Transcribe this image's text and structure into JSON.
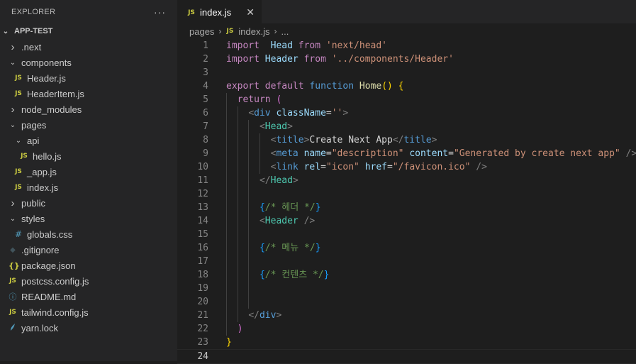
{
  "sidebar": {
    "title": "EXPLORER",
    "more": "···",
    "project": "APP-TEST",
    "items": [
      {
        "label": ".next",
        "kind": "folder",
        "open": false,
        "depth": 1
      },
      {
        "label": "components",
        "kind": "folder",
        "open": true,
        "depth": 1
      },
      {
        "label": "Header.js",
        "kind": "js",
        "depth": 2
      },
      {
        "label": "HeaderItem.js",
        "kind": "js",
        "depth": 2
      },
      {
        "label": "node_modules",
        "kind": "folder",
        "open": false,
        "depth": 1
      },
      {
        "label": "pages",
        "kind": "folder",
        "open": true,
        "depth": 1
      },
      {
        "label": "api",
        "kind": "folder",
        "open": true,
        "depth": 2
      },
      {
        "label": "hello.js",
        "kind": "js",
        "depth": 3
      },
      {
        "label": "_app.js",
        "kind": "js",
        "depth": 2
      },
      {
        "label": "index.js",
        "kind": "js",
        "depth": 2
      },
      {
        "label": "public",
        "kind": "folder",
        "open": false,
        "depth": 1
      },
      {
        "label": "styles",
        "kind": "folder",
        "open": true,
        "depth": 1
      },
      {
        "label": "globals.css",
        "kind": "css",
        "depth": 2
      },
      {
        "label": ".gitignore",
        "kind": "git",
        "depth": 1
      },
      {
        "label": "package.json",
        "kind": "json",
        "depth": 1
      },
      {
        "label": "postcss.config.js",
        "kind": "js",
        "depth": 1
      },
      {
        "label": "README.md",
        "kind": "info",
        "depth": 1
      },
      {
        "label": "tailwind.config.js",
        "kind": "js",
        "depth": 1
      },
      {
        "label": "yarn.lock",
        "kind": "yarn",
        "depth": 1
      }
    ]
  },
  "tab": {
    "label": "index.js",
    "icon": "JS",
    "close": "✕"
  },
  "breadcrumb": {
    "folder": "pages",
    "file_icon": "JS",
    "file": "index.js",
    "more": "..."
  },
  "icons": {
    "js": "JS",
    "css": "#",
    "git": "◆",
    "json": "{}",
    "info": "ⓘ",
    "yarn": "🧶"
  },
  "editor": {
    "active_line": 24,
    "lines": [
      [
        [
          "kw",
          "import"
        ],
        [
          "",
          "  "
        ],
        [
          "var",
          "Head"
        ],
        [
          "",
          ""
        ],
        [
          "kw",
          " from"
        ],
        [
          "",
          " "
        ],
        [
          "str",
          "'next/head'"
        ]
      ],
      [
        [
          "kw",
          "import"
        ],
        [
          "",
          " "
        ],
        [
          "var",
          "Header"
        ],
        [
          "kw",
          " from"
        ],
        [
          "",
          " "
        ],
        [
          "str",
          "'../components/Header'"
        ]
      ],
      [],
      [
        [
          "kw",
          "export"
        ],
        [
          "",
          " "
        ],
        [
          "kw",
          "default"
        ],
        [
          "",
          " "
        ],
        [
          "kw2",
          "function"
        ],
        [
          "",
          " "
        ],
        [
          "fn",
          "Home"
        ],
        [
          "br",
          "()"
        ],
        [
          "",
          " "
        ],
        [
          "br",
          "{"
        ]
      ],
      [
        [
          "",
          ""
        ],
        [
          "kw",
          "  return"
        ],
        [
          "",
          " "
        ],
        [
          "br2",
          "("
        ]
      ],
      [
        [
          "",
          "    "
        ],
        [
          "gray",
          "<"
        ],
        [
          "tag",
          "div"
        ],
        [
          "",
          " "
        ],
        [
          "attr",
          "className"
        ],
        [
          "",
          "="
        ],
        [
          "str",
          "''"
        ],
        [
          "gray",
          ">"
        ]
      ],
      [
        [
          "",
          "      "
        ],
        [
          "gray",
          "<"
        ],
        [
          "comp",
          "Head"
        ],
        [
          "gray",
          ">"
        ]
      ],
      [
        [
          "",
          "        "
        ],
        [
          "gray",
          "<"
        ],
        [
          "tag",
          "title"
        ],
        [
          "gray",
          ">"
        ],
        [
          "",
          "Create Next App"
        ],
        [
          "gray",
          "</"
        ],
        [
          "tag",
          "title"
        ],
        [
          "gray",
          ">"
        ]
      ],
      [
        [
          "",
          "        "
        ],
        [
          "gray",
          "<"
        ],
        [
          "tag",
          "meta"
        ],
        [
          "",
          " "
        ],
        [
          "attr",
          "name"
        ],
        [
          "",
          "="
        ],
        [
          "str",
          "\"description\""
        ],
        [
          "",
          " "
        ],
        [
          "attr",
          "content"
        ],
        [
          "",
          "="
        ],
        [
          "str",
          "\"Generated by create next app\""
        ],
        [
          "",
          " "
        ],
        [
          "gray",
          "/>"
        ]
      ],
      [
        [
          "",
          "        "
        ],
        [
          "gray",
          "<"
        ],
        [
          "tag",
          "link"
        ],
        [
          "",
          " "
        ],
        [
          "attr",
          "rel"
        ],
        [
          "",
          "="
        ],
        [
          "str",
          "\"icon\""
        ],
        [
          "",
          " "
        ],
        [
          "attr",
          "href"
        ],
        [
          "",
          "="
        ],
        [
          "str",
          "\"/favicon.ico\""
        ],
        [
          "",
          " "
        ],
        [
          "gray",
          "/>"
        ]
      ],
      [
        [
          "",
          "      "
        ],
        [
          "gray",
          "</"
        ],
        [
          "comp",
          "Head"
        ],
        [
          "gray",
          ">"
        ]
      ],
      [],
      [
        [
          "",
          "      "
        ],
        [
          "br3",
          "{"
        ],
        [
          "cm",
          "/* 헤더 */"
        ],
        [
          "br3",
          "}"
        ]
      ],
      [
        [
          "",
          "      "
        ],
        [
          "gray",
          "<"
        ],
        [
          "comp",
          "Header"
        ],
        [
          "",
          " "
        ],
        [
          "gray",
          "/>"
        ]
      ],
      [],
      [
        [
          "",
          "      "
        ],
        [
          "br3",
          "{"
        ],
        [
          "cm",
          "/* 메뉴 */"
        ],
        [
          "br3",
          "}"
        ]
      ],
      [],
      [
        [
          "",
          "      "
        ],
        [
          "br3",
          "{"
        ],
        [
          "cm",
          "/* 컨텐츠 */"
        ],
        [
          "br3",
          "}"
        ]
      ],
      [],
      [],
      [
        [
          "",
          "    "
        ],
        [
          "gray",
          "</"
        ],
        [
          "tag",
          "div"
        ],
        [
          "gray",
          ">"
        ]
      ],
      [
        [
          "",
          "  "
        ],
        [
          "br2",
          ")"
        ]
      ],
      [
        [
          "br",
          "}"
        ]
      ],
      []
    ]
  }
}
